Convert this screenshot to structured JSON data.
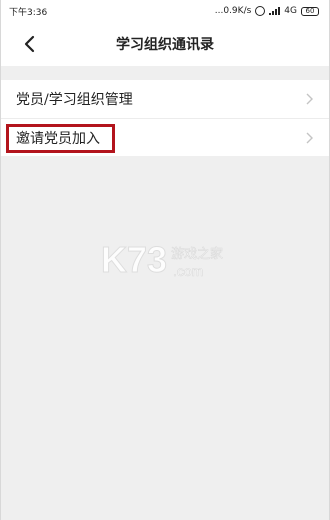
{
  "status_bar": {
    "time": "下午3:36",
    "network_speed": "...0.9K/s",
    "network_type": "4G",
    "battery": "60",
    "icons": [
      "alarm-icon",
      "signal-icon",
      "battery-icon"
    ]
  },
  "header": {
    "title": "学习组织通讯录",
    "back_icon": "back-arrow-icon"
  },
  "menu": {
    "items": [
      {
        "label": "党员/学习组织管理",
        "icon": "chevron-right-icon"
      },
      {
        "label": "邀请党员加入",
        "icon": "chevron-right-icon"
      }
    ]
  },
  "watermark": {
    "logo": "K73",
    "site_cn": "游戏之家",
    "site_domain": ".com"
  },
  "colors": {
    "background": "#efefef",
    "surface": "#ffffff",
    "highlight": "#b3141c",
    "text": "#222222",
    "chevron": "#c4c4c4"
  }
}
